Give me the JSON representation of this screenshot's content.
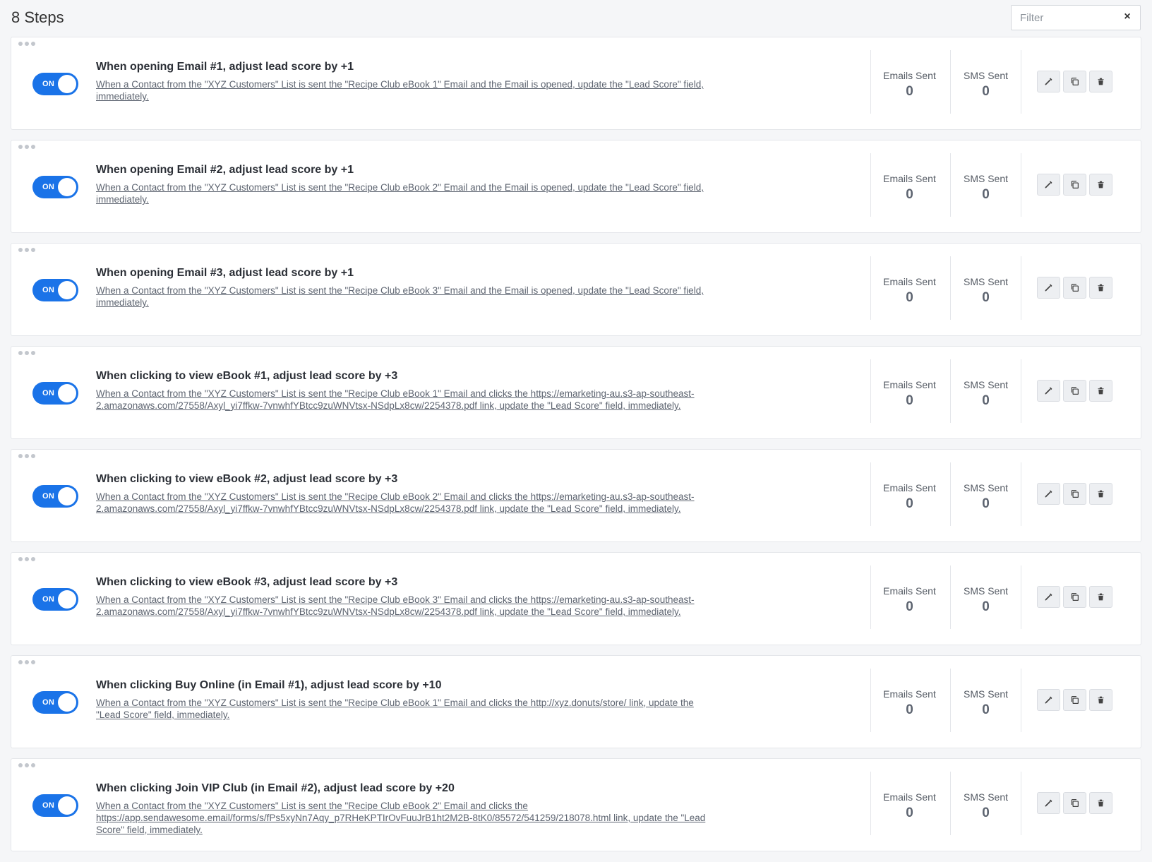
{
  "header": {
    "title": "8 Steps"
  },
  "filter": {
    "placeholder": "Filter",
    "clear_icon": "close-icon"
  },
  "labels": {
    "toggle_on": "ON",
    "emails_sent": "Emails Sent",
    "sms_sent": "SMS Sent"
  },
  "steps": [
    {
      "title": "When opening Email #1, adjust lead score by +1",
      "description": "When a Contact from the \"XYZ Customers\" List is sent the \"Recipe Club eBook 1\" Email and the Email is opened, update the \"Lead Score\" field, immediately.",
      "emails_sent": "0",
      "sms_sent": "0"
    },
    {
      "title": "When opening Email #2, adjust lead score by +1",
      "description": "When a Contact from the \"XYZ Customers\" List is sent the \"Recipe Club eBook 2\" Email and the Email is opened, update the \"Lead Score\" field, immediately.",
      "emails_sent": "0",
      "sms_sent": "0"
    },
    {
      "title": "When opening Email #3, adjust lead score by +1",
      "description": "When a Contact from the \"XYZ Customers\" List is sent the \"Recipe Club eBook 3\" Email and the Email is opened, update the \"Lead Score\" field, immediately.",
      "emails_sent": "0",
      "sms_sent": "0"
    },
    {
      "title": "When clicking to view eBook #1, adjust lead score by +3",
      "description": "When a Contact from the \"XYZ Customers\" List is sent the \"Recipe Club eBook 1\" Email and clicks the https://emarketing-au.s3-ap-southeast-2.amazonaws.com/27558/Axyl_yi7ffkw-7vnwhfYBtcc9zuWNVtsx-NSdpLx8cw/2254378.pdf link, update the \"Lead Score\" field, immediately.",
      "emails_sent": "0",
      "sms_sent": "0"
    },
    {
      "title": "When clicking to view eBook #2, adjust lead score by +3",
      "description": "When a Contact from the \"XYZ Customers\" List is sent the \"Recipe Club eBook 2\" Email and clicks the https://emarketing-au.s3-ap-southeast-2.amazonaws.com/27558/Axyl_yi7ffkw-7vnwhfYBtcc9zuWNVtsx-NSdpLx8cw/2254378.pdf link, update the \"Lead Score\" field, immediately.",
      "emails_sent": "0",
      "sms_sent": "0"
    },
    {
      "title": "When clicking to view eBook #3, adjust lead score by +3",
      "description": "When a Contact from the \"XYZ Customers\" List is sent the \"Recipe Club eBook 3\" Email and clicks the https://emarketing-au.s3-ap-southeast-2.amazonaws.com/27558/Axyl_yi7ffkw-7vnwhfYBtcc9zuWNVtsx-NSdpLx8cw/2254378.pdf link, update the \"Lead Score\" field, immediately.",
      "emails_sent": "0",
      "sms_sent": "0"
    },
    {
      "title": "When clicking Buy Online (in Email #1), adjust lead score by +10",
      "description": "When a Contact from the \"XYZ Customers\" List is sent the \"Recipe Club eBook 1\" Email and clicks the http://xyz.donuts/store/ link, update the \"Lead Score\" field, immediately.",
      "emails_sent": "0",
      "sms_sent": "0"
    },
    {
      "title": "When clicking Join VIP Club (in Email #2), adjust lead score by +20",
      "description": "When a Contact from the \"XYZ Customers\" List is sent the \"Recipe Club eBook 2\" Email and clicks the https://app.sendawesome.email/forms/s/fPs5xyNn7Aqy_p7RHeKPTIrOvFuuJrB1ht2M2B-8tK0/85572/541259/218078.html link, update the \"Lead Score\" field, immediately.",
      "emails_sent": "0",
      "sms_sent": "0"
    }
  ]
}
